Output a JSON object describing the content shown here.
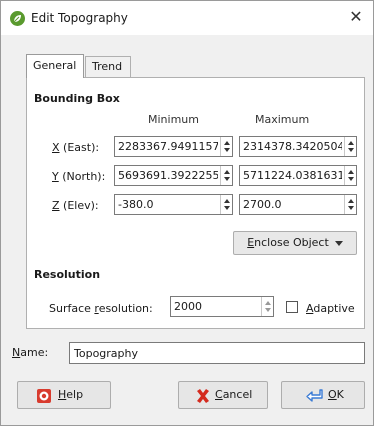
{
  "window": {
    "title": "Edit Topography",
    "close_label": "✕"
  },
  "tabs": [
    {
      "label": "General"
    },
    {
      "label": "Trend"
    }
  ],
  "bounding_box": {
    "title": "Bounding Box",
    "col_min": "Minimum",
    "col_max": "Maximum",
    "rows": [
      {
        "label_key": "X",
        "label_rest": " (East):",
        "min": "2283367.9491157",
        "max": "2314378.3420504"
      },
      {
        "label_key": "Y",
        "label_rest": " (North):",
        "min": "5693691.3922255",
        "max": "5711224.0381631"
      },
      {
        "label_key": "Z",
        "label_rest": " (Elev):",
        "min": "-380.0",
        "max": "2700.0"
      }
    ],
    "enclose_key": "E",
    "enclose_rest": "nclose Object"
  },
  "resolution": {
    "title": "Resolution",
    "label_pre": "Surface ",
    "label_key": "r",
    "label_post": "esolution:",
    "value": "2000",
    "adaptive_key": "A",
    "adaptive_rest": "daptive",
    "adaptive_checked": false
  },
  "name": {
    "label_key": "N",
    "label_rest": "ame:",
    "value": "Topography"
  },
  "footer": {
    "help_key": "H",
    "help_rest": "elp",
    "cancel_key": "C",
    "cancel_rest": "ancel",
    "ok_key": "O",
    "ok_rest": "K"
  },
  "icons": {
    "app": "leaf-icon",
    "close": "close-icon",
    "help": "lifebuoy-icon",
    "cancel": "red-x-icon",
    "ok": "enter-arrow-icon",
    "spin": "spin-arrows-icon",
    "dropdown": "caret-down-icon"
  },
  "colors": {
    "app_icon": "#5a9a2e",
    "help_icon": "#d83b2e",
    "cancel_icon": "#d42a1e",
    "ok_icon": "#3a7bd5"
  }
}
